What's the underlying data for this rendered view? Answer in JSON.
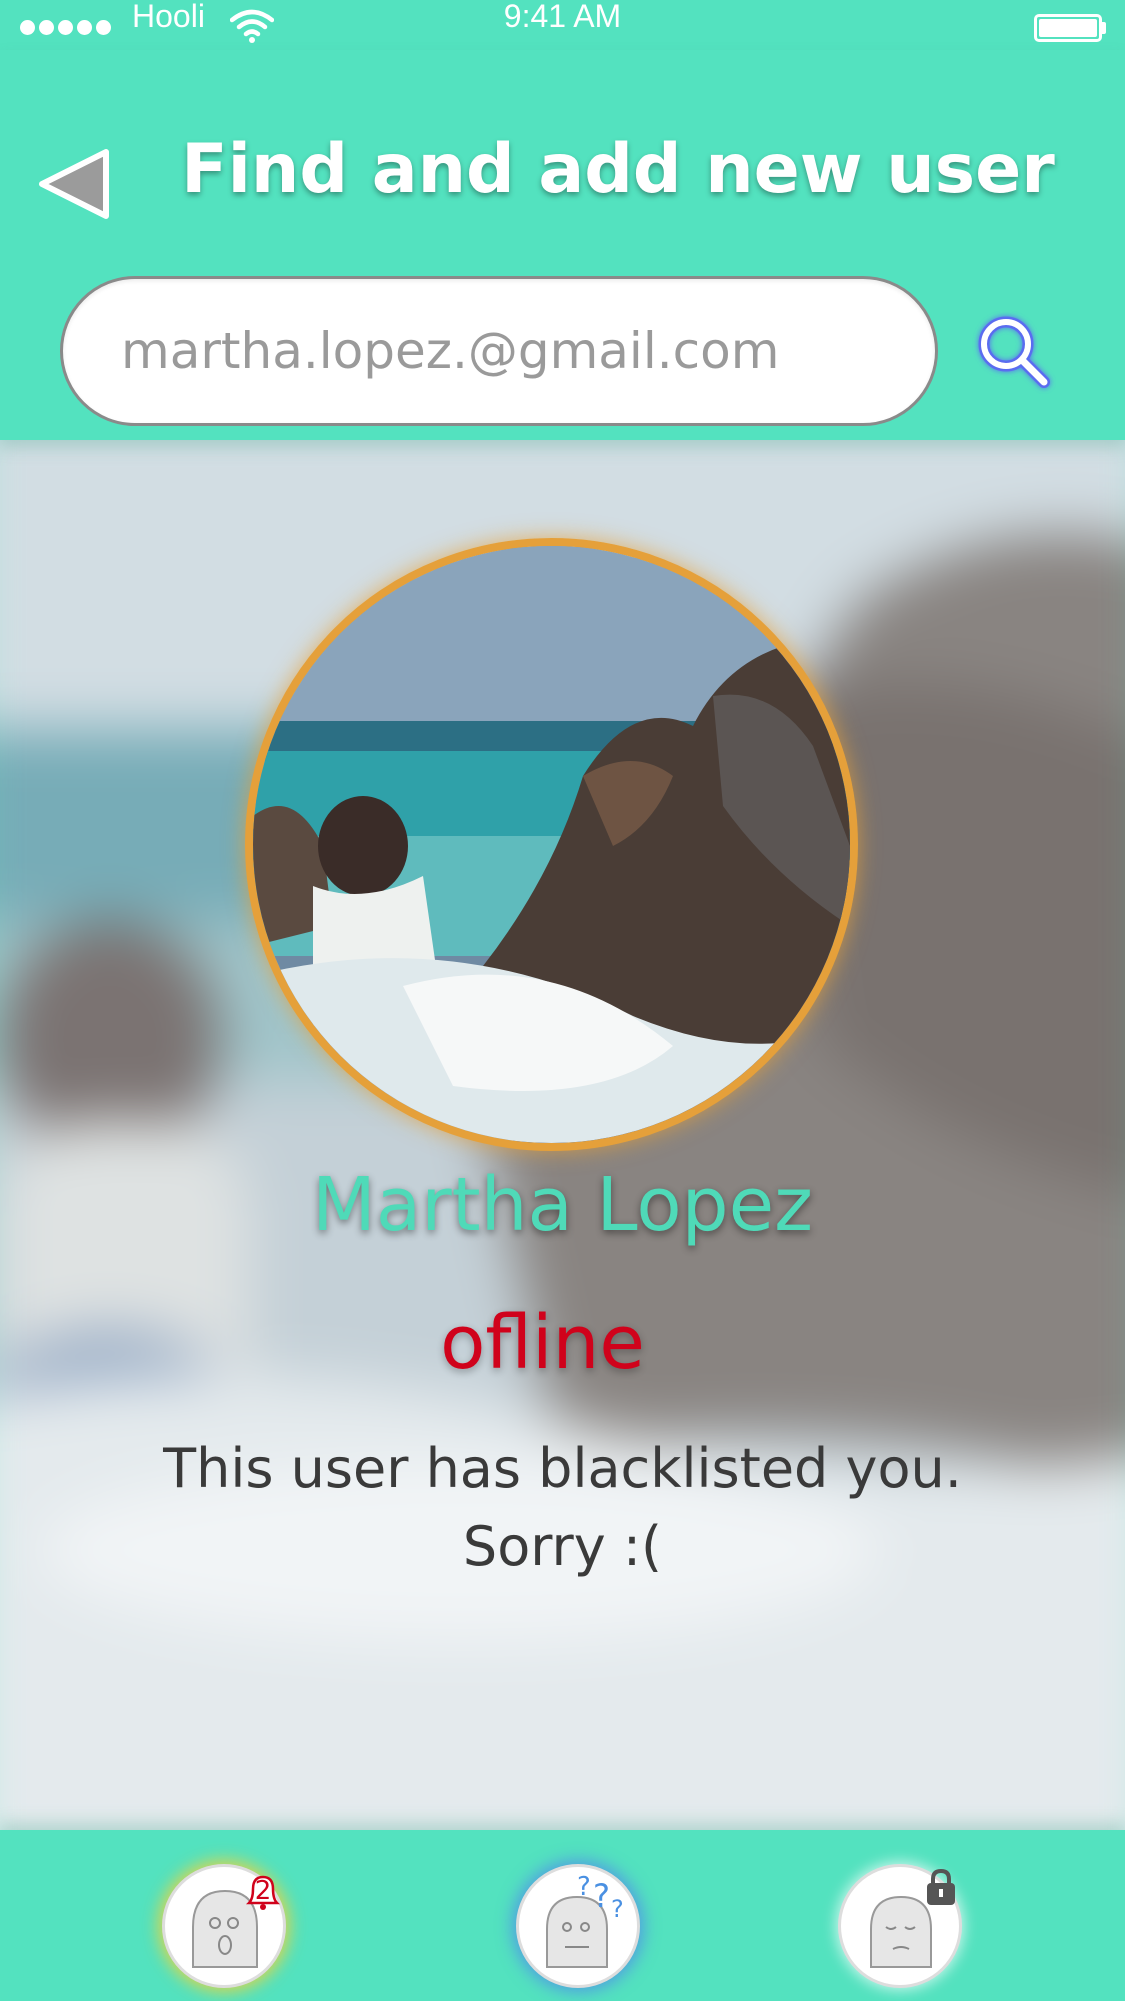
{
  "status_bar": {
    "carrier": "Hooli",
    "time": "9:41 AM"
  },
  "header": {
    "title": "Find and add new user",
    "search": {
      "value": "",
      "placeholder": "martha.lopez.@gmail.com"
    }
  },
  "profile": {
    "name": "Martha Lopez",
    "status": "ofline",
    "message_line1": "This user has blacklisted you.",
    "message_line2": "Sorry :("
  },
  "tab_bar": {
    "notifications_badge": "2"
  },
  "colors": {
    "accent": "#53e2bf",
    "name": "#4fdab8",
    "status": "#d0021b",
    "avatar_ring": "#e5a03a"
  }
}
